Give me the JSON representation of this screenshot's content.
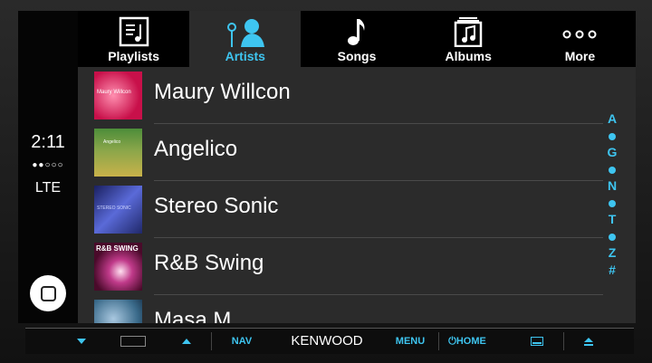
{
  "status": {
    "time": "2:11",
    "signal": "●●○○○",
    "network": "LTE"
  },
  "tabs": [
    {
      "label": "Playlists",
      "icon": "playlist-icon"
    },
    {
      "label": "Artists",
      "icon": "artist-icon",
      "active": true
    },
    {
      "label": "Songs",
      "icon": "music-note-icon"
    },
    {
      "label": "Albums",
      "icon": "album-icon"
    },
    {
      "label": "More",
      "icon": "more-icon"
    }
  ],
  "artists": [
    {
      "name": "Maury Willcon",
      "art_text": "Maury Willcon"
    },
    {
      "name": "Angelico",
      "art_text": "Angelico"
    },
    {
      "name": "Stereo Sonic",
      "art_text": "STEREO SONIC"
    },
    {
      "name": "R&B Swing",
      "art_text": "R&B SWING"
    },
    {
      "name": "Masa M",
      "art_text": ""
    }
  ],
  "index": [
    "A",
    "•",
    "G",
    "•",
    "N",
    "•",
    "T",
    "•",
    "Z",
    "#"
  ],
  "hardware": {
    "nav": "NAV",
    "brand": "KENWOOD",
    "menu": "MENU",
    "home": "⏻HOME"
  },
  "colors": {
    "accent": "#3ec5f0"
  }
}
